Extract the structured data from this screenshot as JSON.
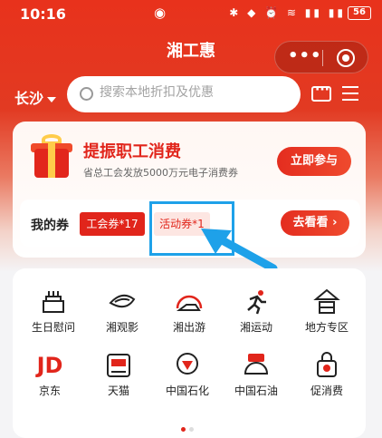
{
  "status_bar": {
    "time": "10:16",
    "battery": "56"
  },
  "app": {
    "title": "湘工惠"
  },
  "header": {
    "city": "长沙",
    "search_placeholder": "搜索本地折扣及优惠"
  },
  "promo": {
    "title": "提振职工消费",
    "subtitle": "省总工会发放5000万元电子消费券",
    "join_label": "立即参与"
  },
  "coupons": {
    "label": "我的券",
    "union_chip": "工会券*17",
    "event_chip": "活动券*1",
    "view_label": "去看看 ›"
  },
  "grid": {
    "items": [
      {
        "label": "生日慰问",
        "icon": "birthday-cake-icon"
      },
      {
        "label": "湘观影",
        "icon": "movie-icon"
      },
      {
        "label": "湘出游",
        "icon": "travel-icon"
      },
      {
        "label": "湘运动",
        "icon": "sports-runner-icon"
      },
      {
        "label": "地方专区",
        "icon": "local-area-icon"
      },
      {
        "label": "京东",
        "icon": "jd-logo-icon"
      },
      {
        "label": "天猫",
        "icon": "tmall-supermarket-icon"
      },
      {
        "label": "中国石化",
        "icon": "sinopec-icon"
      },
      {
        "label": "中国石油",
        "icon": "petrochina-icon"
      },
      {
        "label": "促消费",
        "icon": "shopping-bag-icon"
      }
    ]
  },
  "colors": {
    "brand_red": "#e1251b",
    "highlight_blue": "#1ea1e9"
  },
  "pager": {
    "pages": 2,
    "active": 0
  }
}
